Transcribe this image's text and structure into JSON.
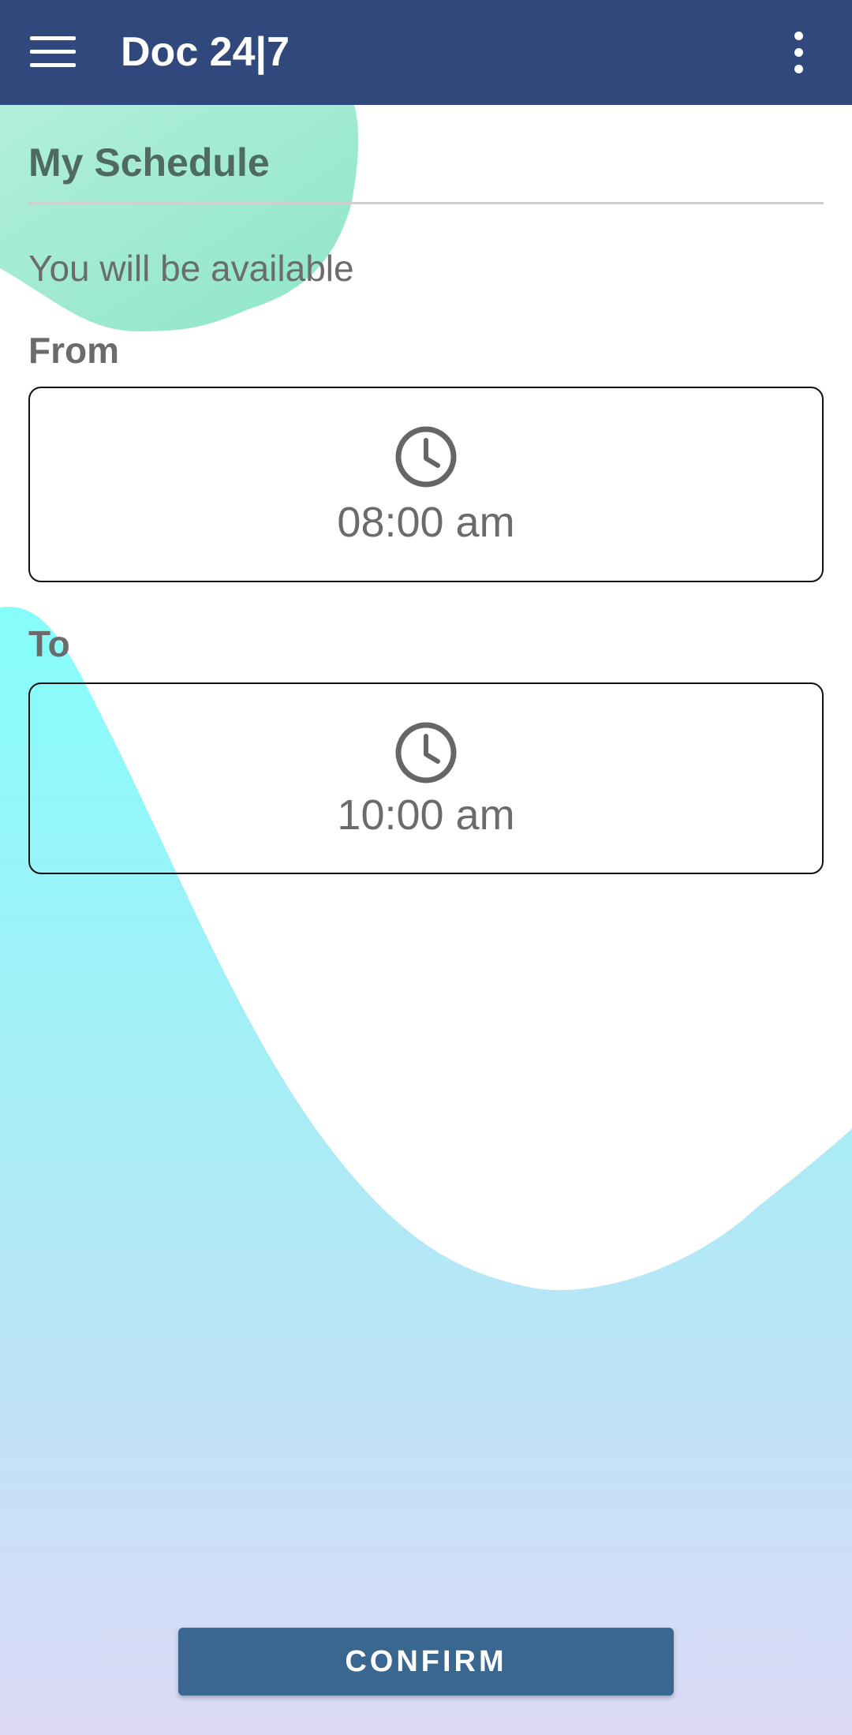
{
  "app_bar": {
    "title": "Doc 24|7",
    "background_color": "#31487c",
    "menu_icon": "hamburger-menu-icon",
    "overflow_icon": "more-vertical-icon"
  },
  "page": {
    "title": "My Schedule",
    "subtitle": "You will be available"
  },
  "from": {
    "label": "From",
    "time": "08:00 am",
    "icon": "clock-icon"
  },
  "to": {
    "label": "To",
    "time": "10:00 am",
    "icon": "clock-icon"
  },
  "confirm": {
    "label": "CONFIRM",
    "color": "#3a6790"
  },
  "colors": {
    "title_text": "#4e6a63",
    "label_text": "#6b6b6b",
    "mint_blob": "#9de9cf",
    "aqua_wave": "#85fdfb",
    "lavender_bottom": "#dadaf6"
  }
}
